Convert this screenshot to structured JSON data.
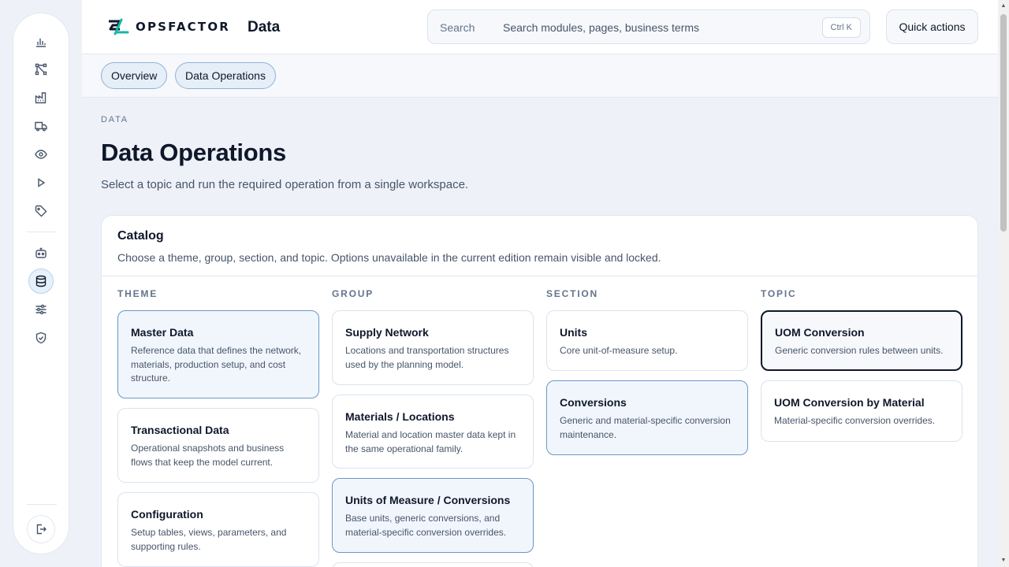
{
  "brand": {
    "name": "OPSFACTOR"
  },
  "header": {
    "title": "Data",
    "search_label": "Search",
    "search_placeholder": "Search modules, pages, business terms",
    "search_shortcut": "Ctrl K",
    "quick_actions_label": "Quick actions"
  },
  "sidebar": {
    "items": [
      {
        "icon": "bar-chart-icon"
      },
      {
        "icon": "network-nodes-icon"
      },
      {
        "icon": "factory-icon"
      },
      {
        "icon": "truck-icon"
      },
      {
        "icon": "eye-icon"
      },
      {
        "icon": "play-icon"
      },
      {
        "icon": "tag-icon"
      },
      {
        "icon": "robot-icon"
      },
      {
        "icon": "database-icon",
        "active": true
      },
      {
        "icon": "sliders-icon"
      },
      {
        "icon": "shield-check-icon"
      }
    ],
    "footer_icon": "logout-icon"
  },
  "tabs": [
    {
      "label": "Overview"
    },
    {
      "label": "Data Operations"
    }
  ],
  "page": {
    "eyebrow": "DATA",
    "title": "Data Operations",
    "subtitle": "Select a topic and run the required operation from a single workspace."
  },
  "catalog": {
    "title": "Catalog",
    "description": "Choose a theme, group, section, and topic. Options unavailable in the current edition remain visible and locked.",
    "columns": {
      "theme": {
        "header": "THEME",
        "cards": [
          {
            "title": "Master Data",
            "desc": "Reference data that defines the network, materials, production setup, and cost structure."
          },
          {
            "title": "Transactional Data",
            "desc": "Operational snapshots and business flows that keep the model current."
          },
          {
            "title": "Configuration",
            "desc": "Setup tables, views, parameters, and supporting rules."
          }
        ]
      },
      "group": {
        "header": "GROUP",
        "cards": [
          {
            "title": "Supply Network",
            "desc": "Locations and transportation structures used by the planning model."
          },
          {
            "title": "Materials / Locations",
            "desc": "Material and location master data kept in the same operational family."
          },
          {
            "title": "Units of Measure / Conversions",
            "desc": "Base units, generic conversions, and material-specific conversion overrides."
          }
        ]
      },
      "section": {
        "header": "SECTION",
        "cards": [
          {
            "title": "Units",
            "desc": "Core unit-of-measure setup."
          },
          {
            "title": "Conversions",
            "desc": "Generic and material-specific conversion maintenance."
          }
        ]
      },
      "topic": {
        "header": "TOPIC",
        "cards": [
          {
            "title": "UOM Conversion",
            "desc": "Generic conversion rules between units."
          },
          {
            "title": "UOM Conversion by Material",
            "desc": "Material-specific conversion overrides."
          }
        ]
      }
    }
  }
}
